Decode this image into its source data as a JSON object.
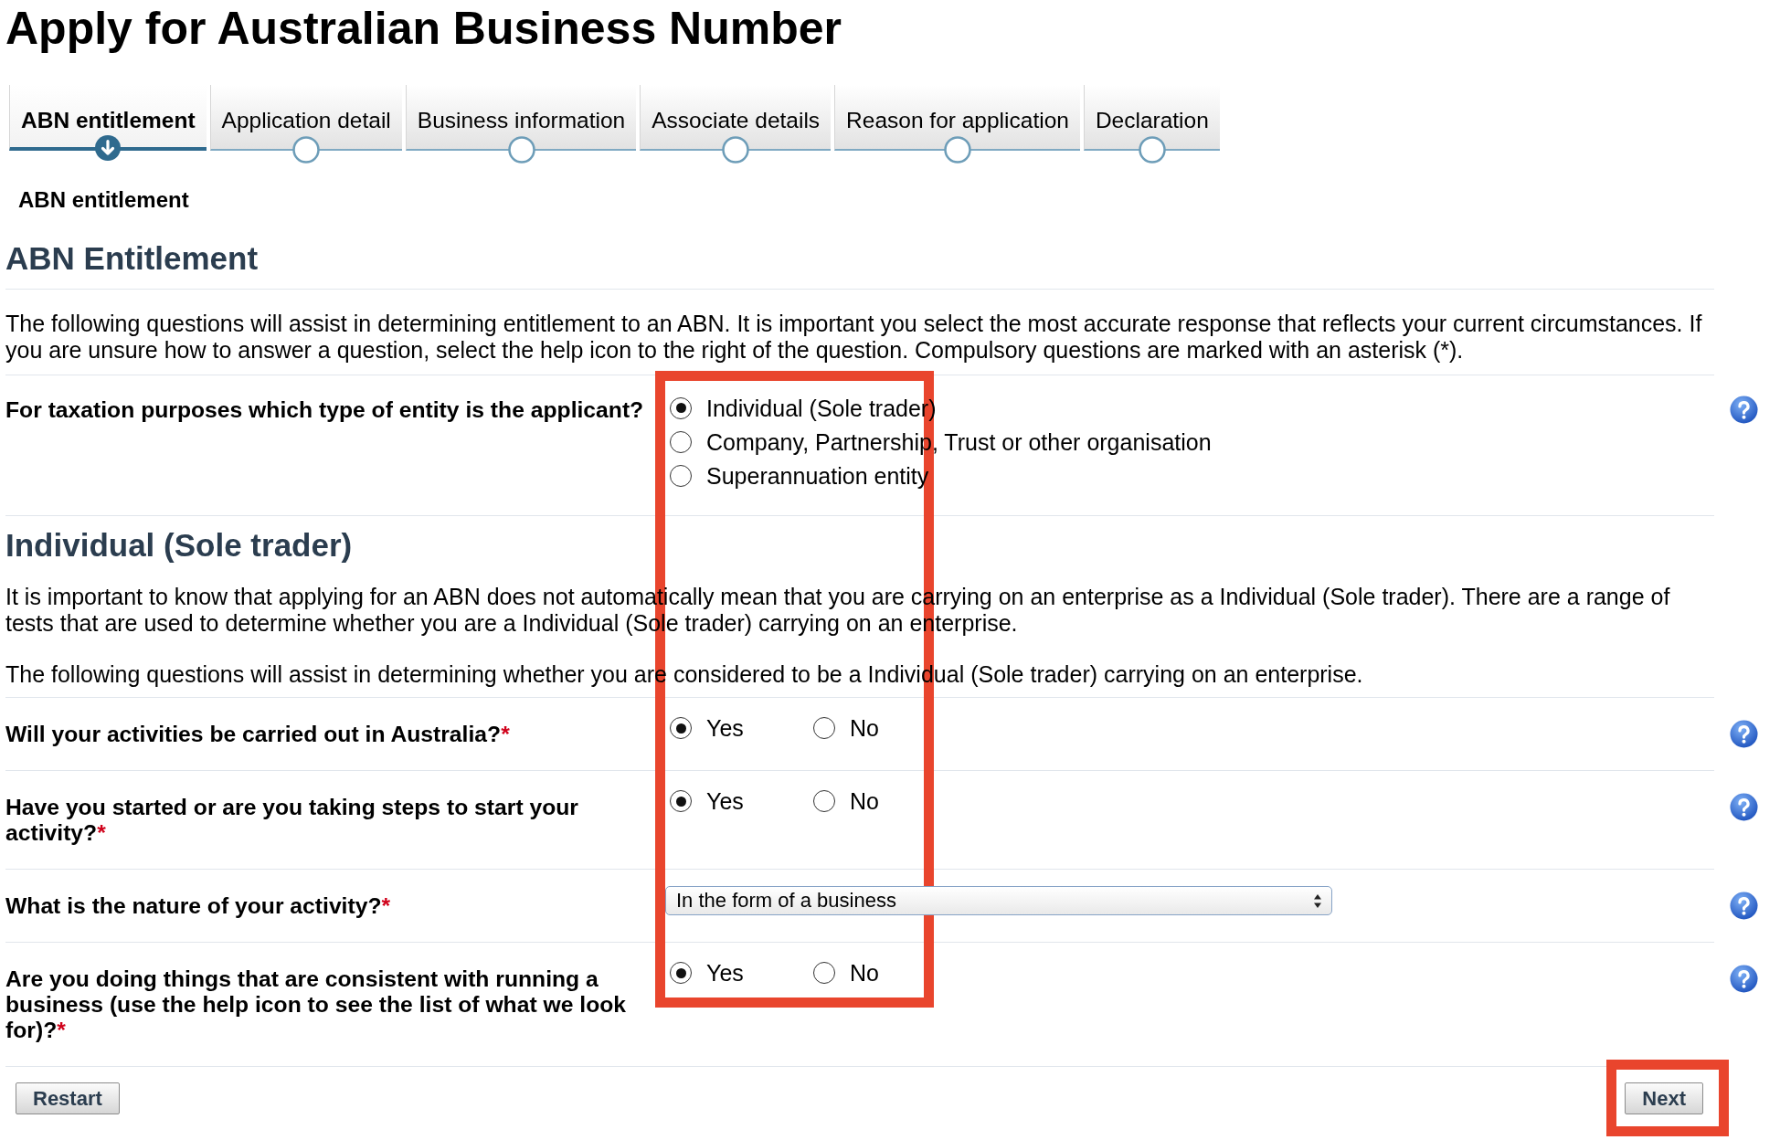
{
  "page": {
    "title": "Apply for Australian Business Number"
  },
  "steps": [
    {
      "label": "ABN entitlement",
      "selected": true
    },
    {
      "label": "Application detail",
      "selected": false
    },
    {
      "label": "Business information",
      "selected": false
    },
    {
      "label": "Associate details",
      "selected": false
    },
    {
      "label": "Reason for application",
      "selected": false
    },
    {
      "label": "Declaration",
      "selected": false
    }
  ],
  "current_step": "ABN entitlement",
  "entitlement": {
    "heading": "ABN Entitlement",
    "paragraphs": [
      "The following questions will assist in determining entitlement to an ABN. It is important you select the most accurate response that reflects your current circumstances. If you are unsure how to answer a question, select the help icon to the right of the question. Compulsory questions are marked with an asterisk (*)."
    ],
    "questions": [
      {
        "kind": "radio_list",
        "label": "For taxation purposes which type of entity is the applicant?",
        "options": [
          {
            "label": "Individual (Sole trader)",
            "selected": true
          },
          {
            "label": "Company, Partnership, Trust or other organisation",
            "selected": false
          },
          {
            "label": "Superannuation entity",
            "selected": false
          }
        ]
      }
    ]
  },
  "entity_details": {
    "heading": "Individual (Sole trader)",
    "paragraphs": [
      "It is important to know that applying for an ABN does not automatically mean that you are carrying on an enterprise as a Individual (Sole trader). There are a range of tests that are used to determine whether you are a Individual (Sole trader) carrying on an enterprise.",
      "The following questions will assist in determining whether you are considered to be a Individual (Sole trader) carrying on an enterprise."
    ],
    "questions": [
      {
        "kind": "yes_no",
        "label": "Will your activities be carried out in Australia?",
        "required_marker": "*",
        "options": [
          {
            "label": "Yes",
            "selected": true
          },
          {
            "label": "No",
            "selected": false
          }
        ]
      },
      {
        "kind": "yes_no",
        "label": "Have you started or are you taking steps to start your activity?",
        "required_marker": "*",
        "options": [
          {
            "label": "Yes",
            "selected": true
          },
          {
            "label": "No",
            "selected": false
          }
        ]
      },
      {
        "kind": "select",
        "label": "What is the nature of your activity?",
        "required_marker": "*",
        "value": "In the form of a business"
      },
      {
        "kind": "yes_no",
        "label": "Are you doing things that are consistent with running a business (use the help icon to see the list of what we look for)?",
        "required_marker": "*",
        "options": [
          {
            "label": "Yes",
            "selected": true
          },
          {
            "label": "No",
            "selected": false
          }
        ]
      }
    ]
  },
  "buttons": [
    {
      "label": "Restart"
    },
    {
      "label": "Next"
    }
  ]
}
